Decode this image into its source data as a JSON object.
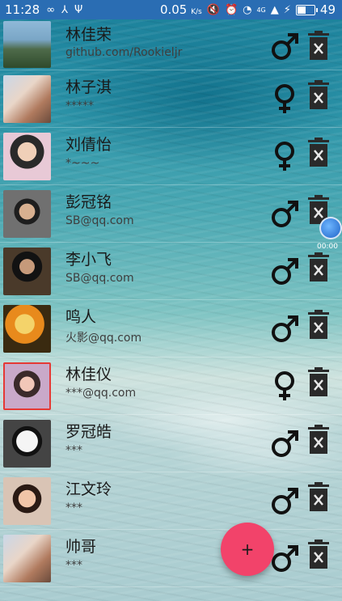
{
  "status_bar": {
    "time": "11:28",
    "speed": "0.05",
    "speed_unit": "K/s",
    "network": "4G",
    "battery_level": "49"
  },
  "contacts": [
    {
      "name": "林佳荣",
      "email": "github.com/Rookieljr",
      "gender": "male"
    },
    {
      "name": "林子淇",
      "email": "*****",
      "gender": "female"
    },
    {
      "name": "刘倩怡",
      "email": "*~~~",
      "gender": "female"
    },
    {
      "name": "彭冠铭",
      "email": "SB@qq.com",
      "gender": "male"
    },
    {
      "name": "李小飞",
      "email": "SB@qq.com",
      "gender": "male"
    },
    {
      "name": "鸣人",
      "email": "火影@qq.com",
      "gender": "male"
    },
    {
      "name": "林佳仪",
      "email": "***@qq.com",
      "gender": "female"
    },
    {
      "name": "罗冠皓",
      "email": "***",
      "gender": "male"
    },
    {
      "name": "江文玲",
      "email": "***",
      "gender": "male"
    },
    {
      "name": "帅哥",
      "email": "***",
      "gender": "male"
    }
  ],
  "floating_timer": "00:00",
  "fab": {
    "label": "+"
  }
}
